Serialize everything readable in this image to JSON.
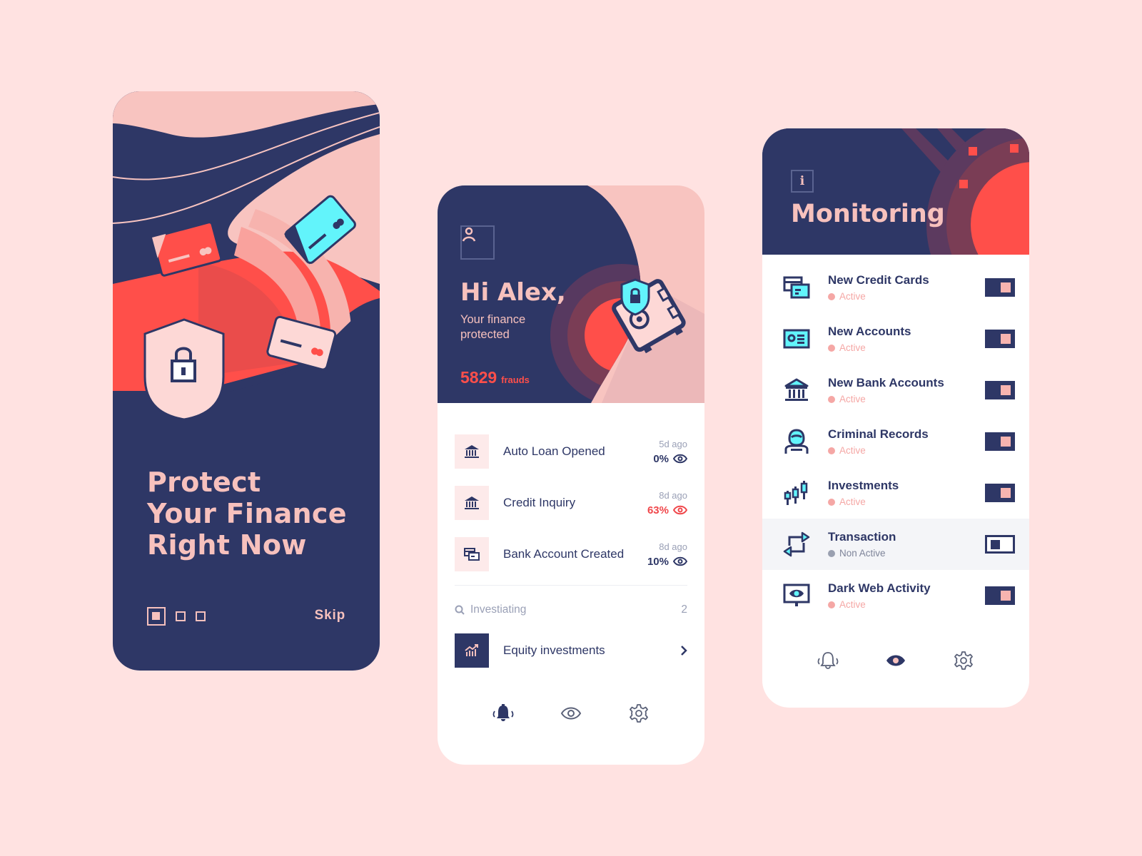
{
  "colors": {
    "background": "#ffe2e1",
    "navy": "#2e3766",
    "pink": "#f7c1bd",
    "coral": "#ff4f4a",
    "cyan": "#62f4fb"
  },
  "onboarding": {
    "headline": [
      "Protect",
      "Your Finance",
      "Right Now"
    ],
    "pager": {
      "total": 3,
      "current": 1
    },
    "skip_label": "Skip"
  },
  "dashboard": {
    "avatar_icon": "user-icon",
    "greeting": "Hi Alex,",
    "subtitle": "Your finance protected",
    "fraud_count": "5829",
    "fraud_unit": "frauds",
    "alerts": [
      {
        "icon": "bank-icon",
        "title": "Auto Loan Opened",
        "ago": "5d ago",
        "percent": "0%",
        "level": "normal"
      },
      {
        "icon": "bank-icon",
        "title": "Credit Inquiry",
        "ago": "8d ago",
        "percent": "63%",
        "level": "high"
      },
      {
        "icon": "cards-icon",
        "title": "Bank Account Created",
        "ago": "8d ago",
        "percent": "10%",
        "level": "normal"
      }
    ],
    "investigating": {
      "label": "Investiating",
      "count": "2"
    },
    "equity": {
      "icon": "chart-up-icon",
      "title": "Equity investments"
    },
    "tabs": [
      {
        "icon": "bell-icon",
        "active": true
      },
      {
        "icon": "eye-icon",
        "active": false
      },
      {
        "icon": "gear-icon",
        "active": false
      }
    ]
  },
  "monitoring": {
    "info_icon": "i",
    "title": "Monitoring",
    "items": [
      {
        "icon": "credit-cards-icon",
        "name": "New Credit Cards",
        "status": "Active",
        "enabled": true
      },
      {
        "icon": "id-card-icon",
        "name": "New Accounts",
        "status": "Active",
        "enabled": true
      },
      {
        "icon": "bank-icon",
        "name": "New Bank Accounts",
        "status": "Active",
        "enabled": true
      },
      {
        "icon": "hooded-person-icon",
        "name": "Criminal Records",
        "status": "Active",
        "enabled": true
      },
      {
        "icon": "candlestick-icon",
        "name": "Investments",
        "status": "Active",
        "enabled": true
      },
      {
        "icon": "transfer-arrows-icon",
        "name": "Transaction",
        "status": "Non Active",
        "enabled": false
      },
      {
        "icon": "monitor-eye-icon",
        "name": "Dark Web Activity",
        "status": "Active",
        "enabled": true
      }
    ],
    "tabs": [
      {
        "icon": "bell-icon",
        "active": false
      },
      {
        "icon": "eye-icon",
        "active": true
      },
      {
        "icon": "gear-icon",
        "active": false
      }
    ]
  }
}
